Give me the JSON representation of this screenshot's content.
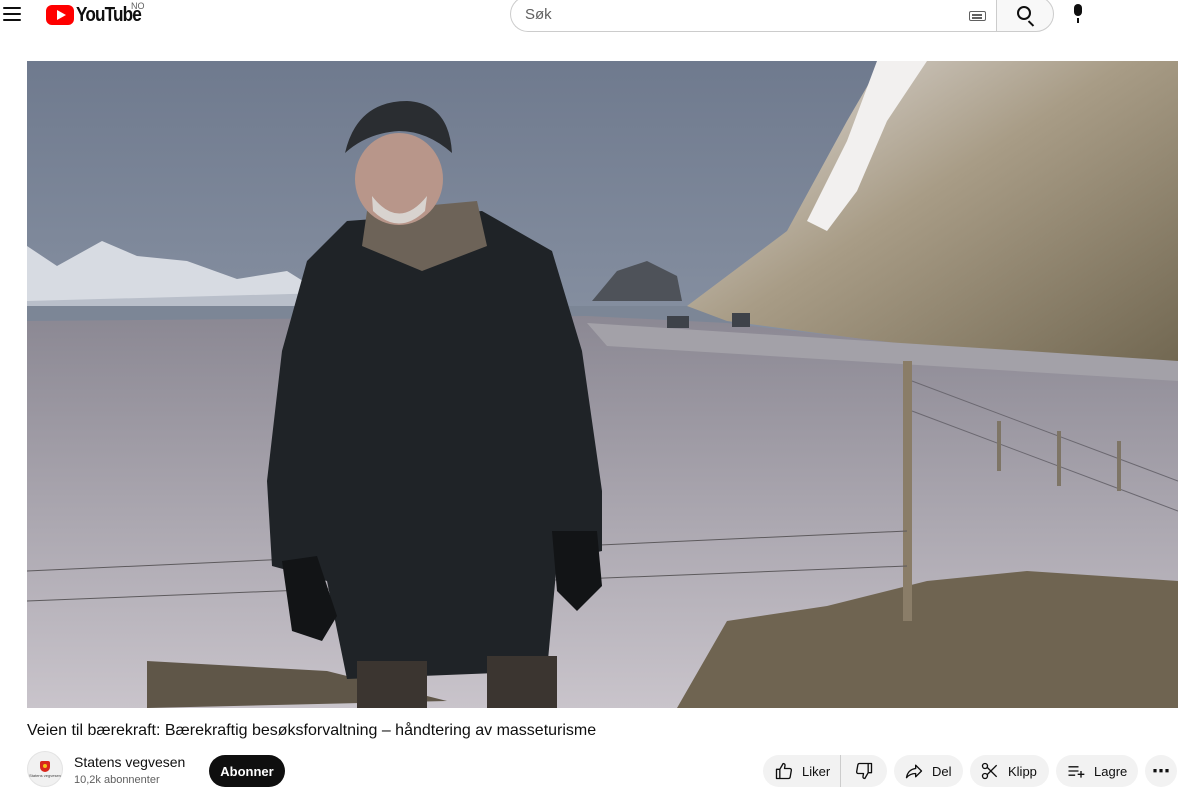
{
  "header": {
    "logo_text": "YouTube",
    "country_code": "NO",
    "search_placeholder": "Søk"
  },
  "video": {
    "title": "Veien til bærekraft: Bærekraftig besøksforvaltning – håndtering av masseturisme"
  },
  "channel": {
    "name": "Statens vegvesen",
    "subscribers": "10,2k abonnenter",
    "avatar_text": "Statens vegvesen",
    "subscribe_label": "Abonner"
  },
  "actions": {
    "like_label": "Liker",
    "share_label": "Del",
    "clip_label": "Klipp",
    "save_label": "Lagre",
    "more_label": "⋯"
  },
  "icons": {
    "menu": "menu-icon",
    "search": "search-icon",
    "keyboard": "keyboard-icon",
    "mic": "mic-icon",
    "like": "thumbs-up-icon",
    "dislike": "thumbs-down-icon",
    "share": "share-arrow-icon",
    "clip": "scissors-icon",
    "save": "playlist-add-icon"
  },
  "colors": {
    "brand_red": "#ff0000",
    "subscribe_bg": "#0f0f0f",
    "pill_bg": "#f2f2f2"
  }
}
